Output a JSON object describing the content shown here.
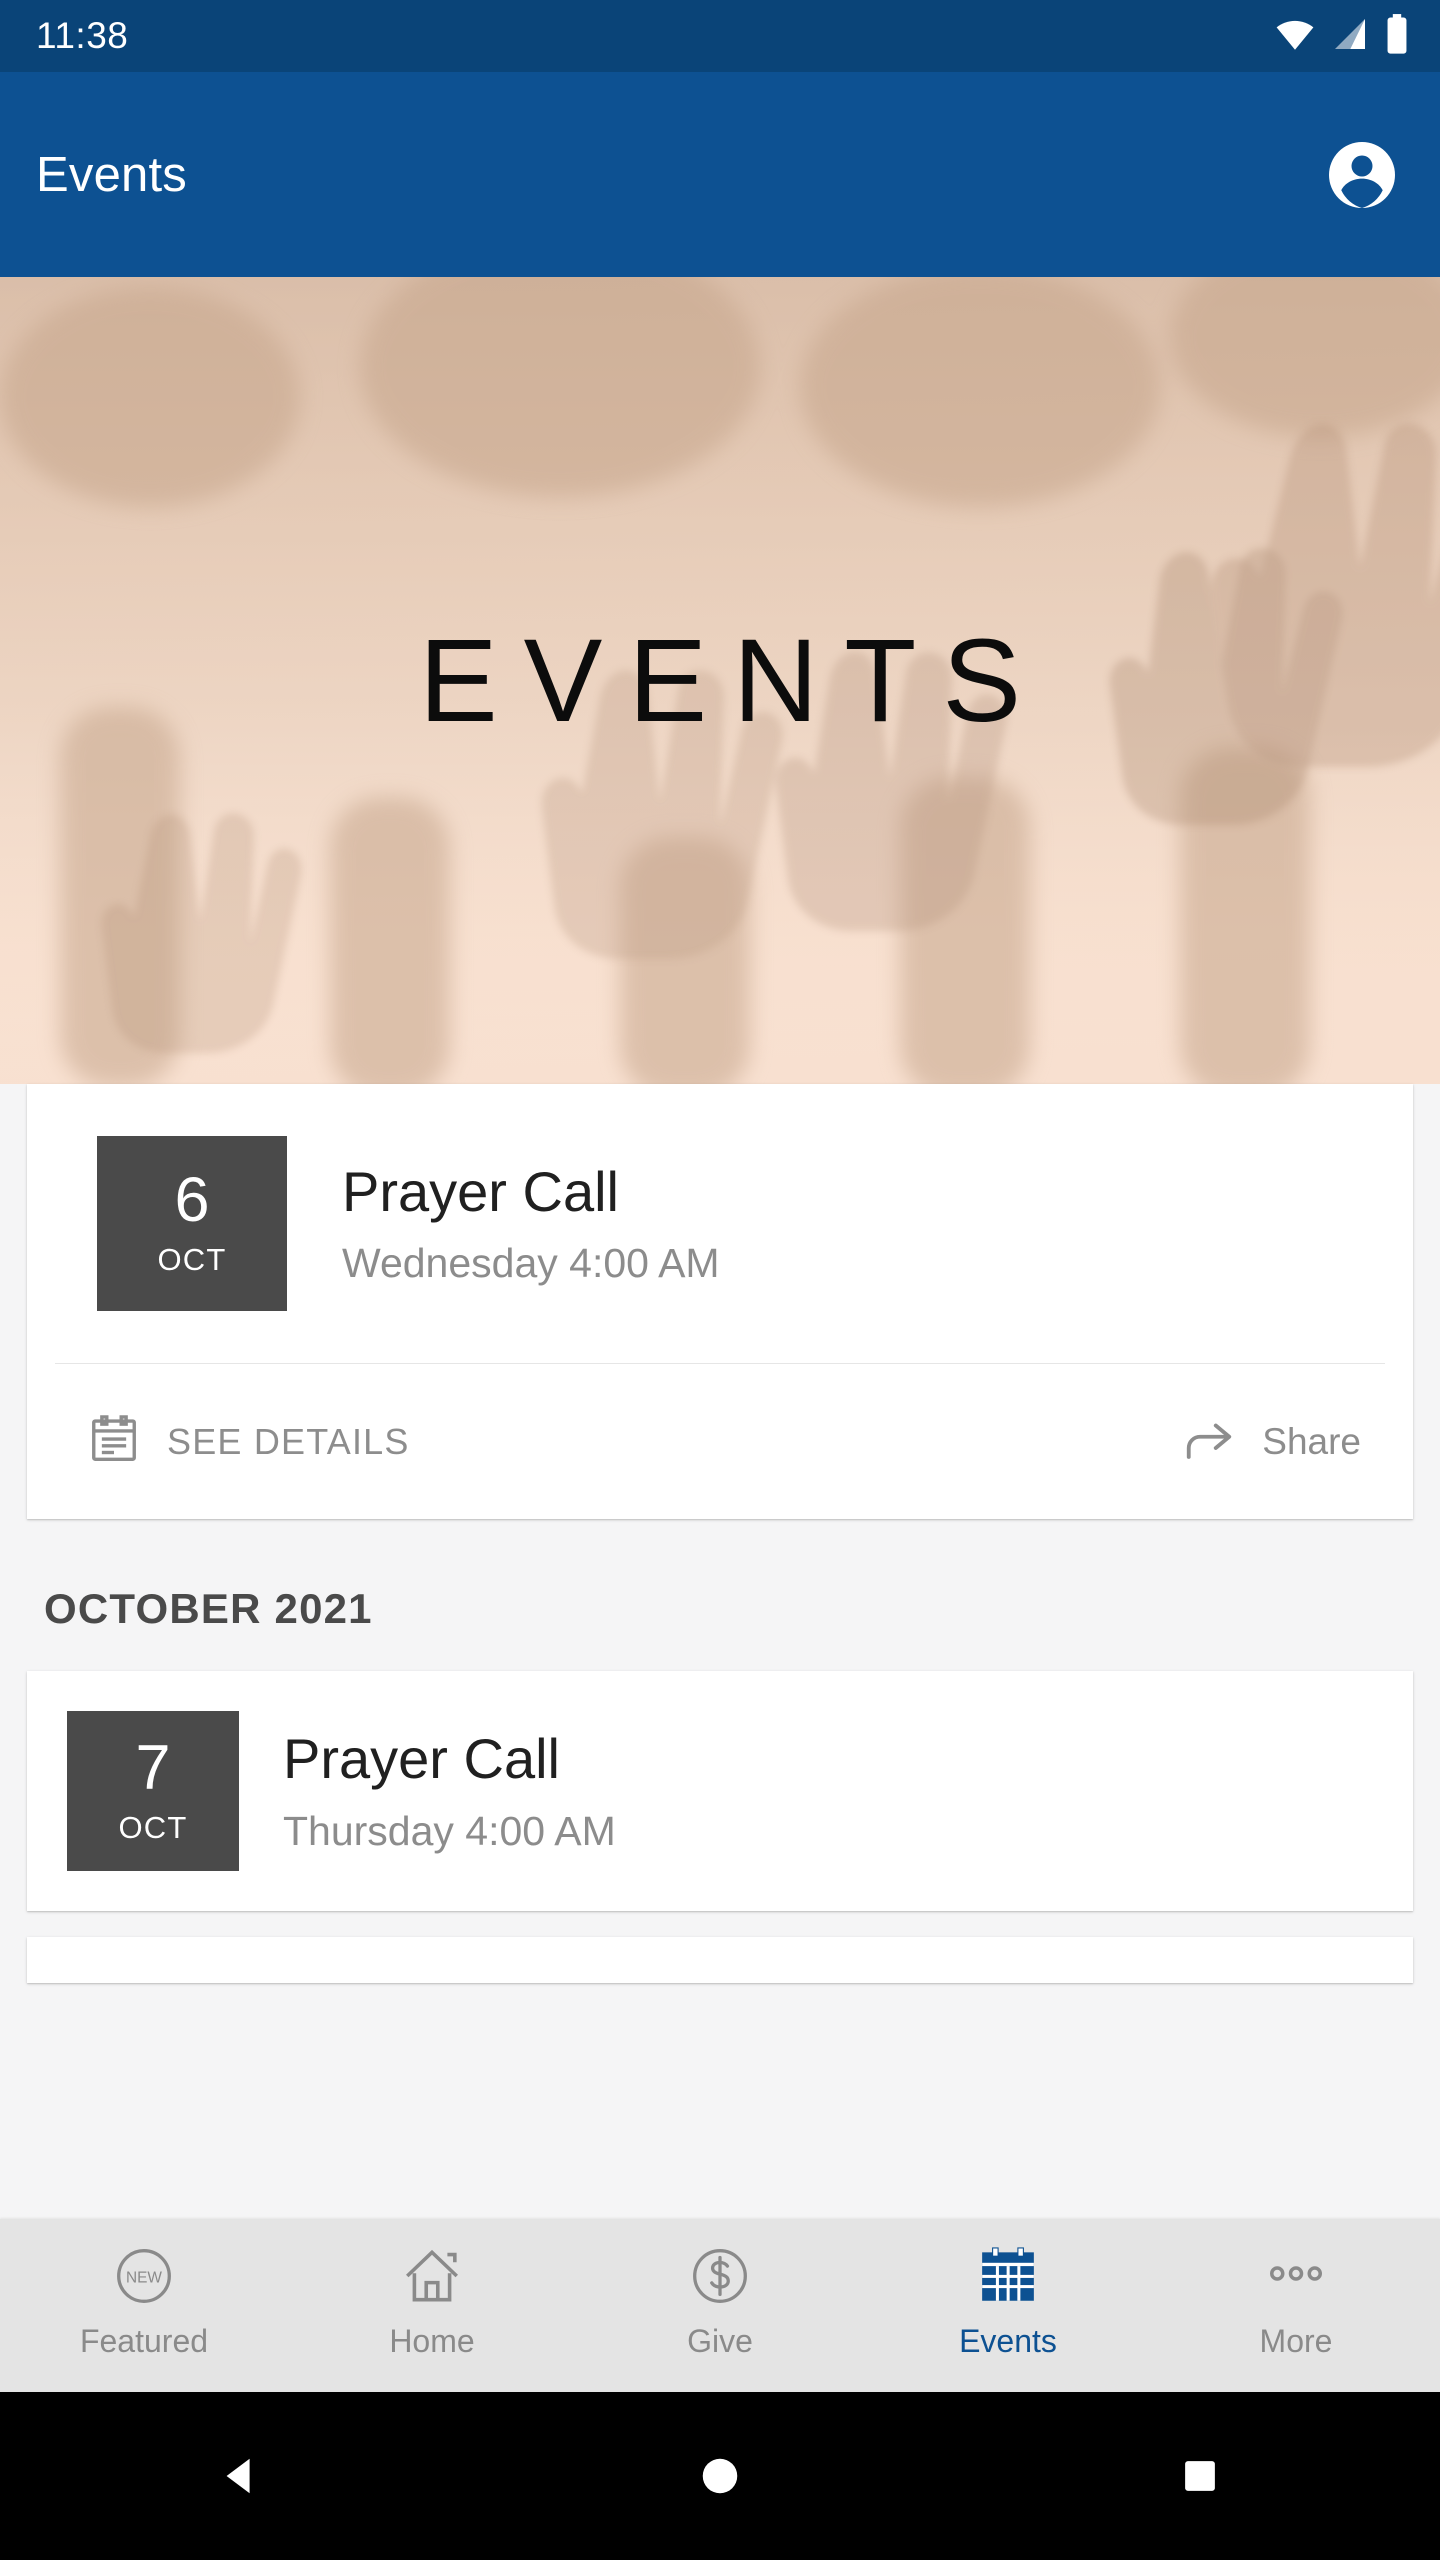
{
  "status_bar": {
    "time": "11:38",
    "icons": [
      "wifi-icon",
      "cellular-signal-icon",
      "battery-icon"
    ]
  },
  "app_bar": {
    "title": "Events",
    "account_icon": "account-circle-icon"
  },
  "hero": {
    "title": "EVENTS",
    "description": "blurred sepia photo of raised hands",
    "colors": {
      "light": "#f8e0d0",
      "dark": "#e6cdb9"
    }
  },
  "featured_event": {
    "day": "6",
    "month": "OCT",
    "title": "Prayer Call",
    "datetime": "Wednesday 4:00 AM",
    "actions": {
      "details_label": "SEE DETAILS",
      "details_icon": "event-note-icon",
      "share_label": "Share",
      "share_icon": "share-arrow-icon"
    }
  },
  "month_section": {
    "header": "OCTOBER 2021",
    "events": [
      {
        "day": "7",
        "month": "OCT",
        "title": "Prayer Call",
        "datetime": "Thursday 4:00 AM"
      }
    ]
  },
  "bottom_nav": {
    "active_color": "#0d5192",
    "inactive_color": "#8a8a8a",
    "tabs": [
      {
        "label": "Featured",
        "icon": "new-badge-icon",
        "active": false
      },
      {
        "label": "Home",
        "icon": "home-icon",
        "active": false
      },
      {
        "label": "Give",
        "icon": "dollar-circle-icon",
        "active": false
      },
      {
        "label": "Events",
        "icon": "calendar-icon",
        "active": true
      },
      {
        "label": "More",
        "icon": "more-dots-icon",
        "active": false
      }
    ]
  },
  "system_nav": {
    "back": "back-triangle-icon",
    "home": "home-circle-icon",
    "recents": "recents-square-icon"
  }
}
